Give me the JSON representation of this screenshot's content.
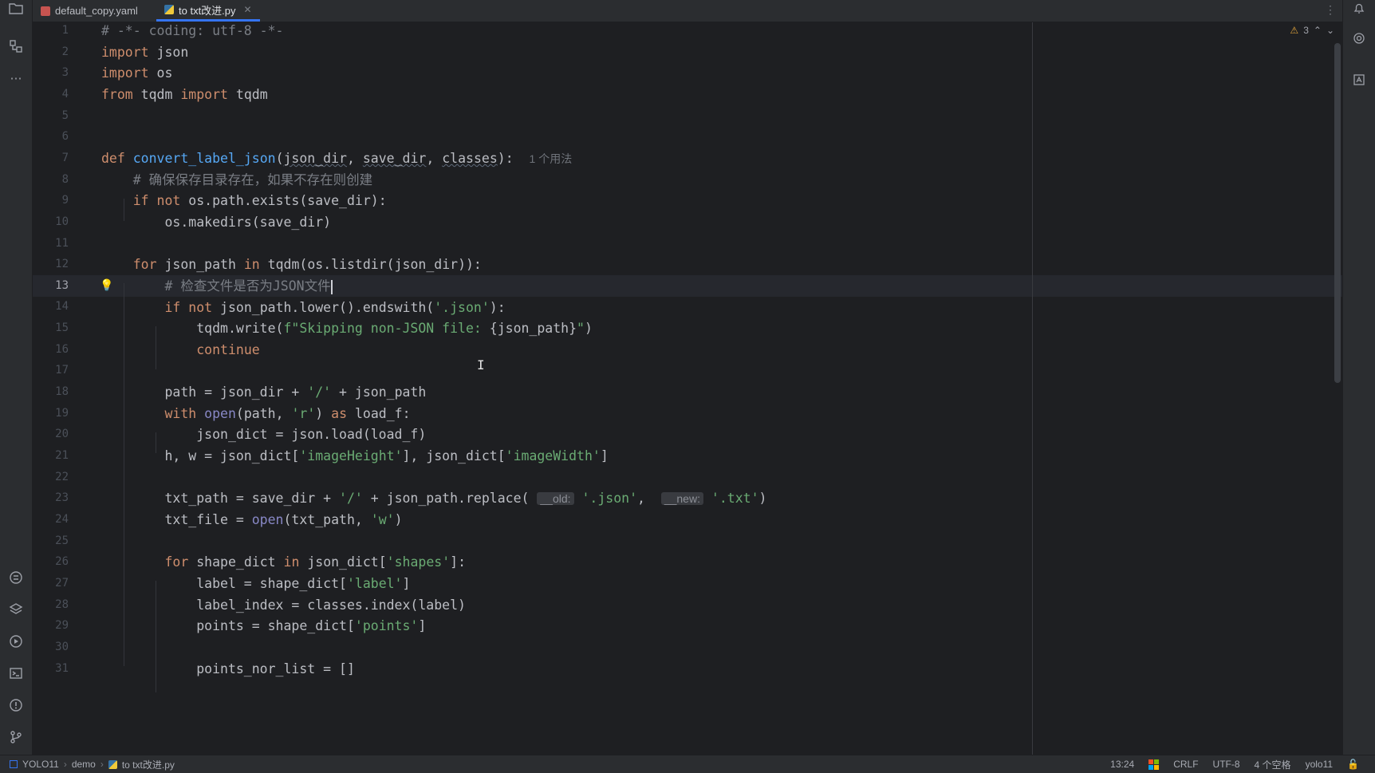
{
  "tabs": [
    {
      "label": "default_copy.yaml",
      "active": false,
      "icon": "yaml-file-icon"
    },
    {
      "label": "to txt改进.py",
      "active": true,
      "icon": "python-file-icon"
    }
  ],
  "editor": {
    "warning_count": "3",
    "current_line": 13,
    "line_numbers": [
      "1",
      "2",
      "3",
      "4",
      "5",
      "6",
      "7",
      "8",
      "9",
      "10",
      "11",
      "12",
      "13",
      "14",
      "15",
      "16",
      "17",
      "18",
      "19",
      "20",
      "21",
      "22",
      "23",
      "24",
      "25",
      "26",
      "27",
      "28",
      "29",
      "30",
      "31"
    ],
    "usage_hint": "1 个用法",
    "comment_line8": "# 确保保存目录存在，如果不存在则创建",
    "comment_line13": "# 检查文件是否为JSON文件",
    "inlay_old": "__old:",
    "inlay_new": "__new:"
  },
  "statusbar": {
    "breadcrumbs": [
      "YOLO11",
      "demo",
      "to txt改进.py"
    ],
    "position": "13:24",
    "line_ending": "CRLF",
    "encoding": "UTF-8",
    "indent": "4 个空格",
    "interpreter": "yolo11"
  },
  "colors": {
    "background": "#1e1f22",
    "keyword": "#cf8e6d",
    "function": "#56a8f5",
    "string": "#6aab73",
    "comment": "#7a7e85",
    "accent": "#3574f0"
  }
}
